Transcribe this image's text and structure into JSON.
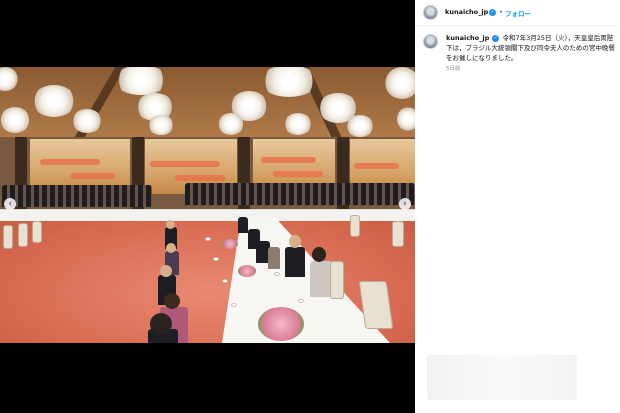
{
  "post": {
    "username": "kunaicho_jp",
    "separator": "•",
    "follow_label": "フォロー",
    "caption_text": "令和7年3月25日（火），天皇皇后両陛下は，ブラジル大統領閣下及び同令夫人のための宮中晩餐をお催しになりました。",
    "time_ago": "5日前"
  },
  "icons": {
    "verified": "verified-badge-icon",
    "avatar": "account-avatar",
    "prev": "chevron-left-icon",
    "next": "chevron-right-icon"
  },
  "colors": {
    "accent": "#0095f6",
    "verified": "#1f8bf1",
    "media_bg": "#000000"
  },
  "media": {
    "image_alt": ""
  }
}
